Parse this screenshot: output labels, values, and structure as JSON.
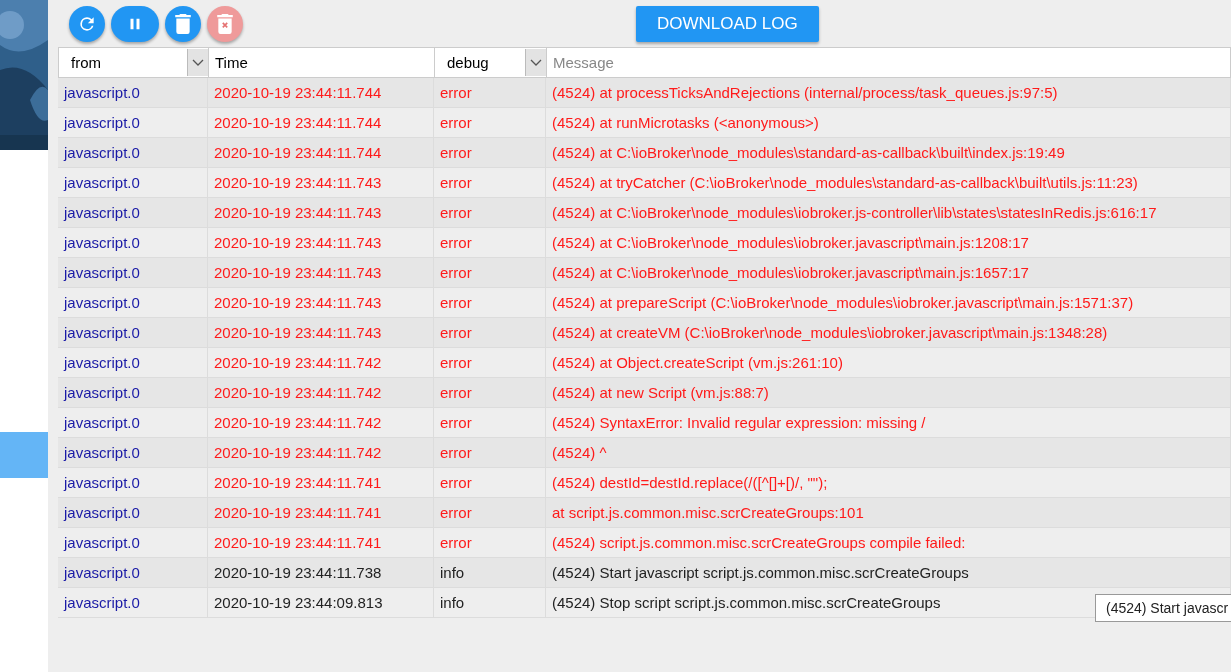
{
  "toolbar": {
    "buttons": [
      {
        "kind": "refresh",
        "disabled": false
      },
      {
        "kind": "pause",
        "disabled": false
      },
      {
        "kind": "delete",
        "disabled": false
      },
      {
        "kind": "delete-log",
        "disabled": true
      }
    ],
    "download": "DOWNLOAD LOG"
  },
  "filters": {
    "from": "from",
    "time": "Time",
    "level": "debug",
    "message_placeholder": "Message"
  },
  "rows": [
    {
      "from": "javascript.0",
      "time": "2020-10-19 23:44:11.744",
      "severity": "error",
      "message": "(4524) at processTicksAndRejections (internal/process/task_queues.js:97:5)"
    },
    {
      "from": "javascript.0",
      "time": "2020-10-19 23:44:11.744",
      "severity": "error",
      "message": "(4524) at runMicrotasks (<anonymous>)"
    },
    {
      "from": "javascript.0",
      "time": "2020-10-19 23:44:11.744",
      "severity": "error",
      "message": "(4524) at C:\\ioBroker\\node_modules\\standard-as-callback\\built\\index.js:19:49"
    },
    {
      "from": "javascript.0",
      "time": "2020-10-19 23:44:11.743",
      "severity": "error",
      "message": "(4524) at tryCatcher (C:\\ioBroker\\node_modules\\standard-as-callback\\built\\utils.js:11:23)"
    },
    {
      "from": "javascript.0",
      "time": "2020-10-19 23:44:11.743",
      "severity": "error",
      "message": "(4524) at C:\\ioBroker\\node_modules\\iobroker.js-controller\\lib\\states\\statesInRedis.js:616:17"
    },
    {
      "from": "javascript.0",
      "time": "2020-10-19 23:44:11.743",
      "severity": "error",
      "message": "(4524) at C:\\ioBroker\\node_modules\\iobroker.javascript\\main.js:1208:17"
    },
    {
      "from": "javascript.0",
      "time": "2020-10-19 23:44:11.743",
      "severity": "error",
      "message": "(4524) at C:\\ioBroker\\node_modules\\iobroker.javascript\\main.js:1657:17"
    },
    {
      "from": "javascript.0",
      "time": "2020-10-19 23:44:11.743",
      "severity": "error",
      "message": "(4524) at prepareScript (C:\\ioBroker\\node_modules\\iobroker.javascript\\main.js:1571:37)"
    },
    {
      "from": "javascript.0",
      "time": "2020-10-19 23:44:11.743",
      "severity": "error",
      "message": "(4524) at createVM (C:\\ioBroker\\node_modules\\iobroker.javascript\\main.js:1348:28)"
    },
    {
      "from": "javascript.0",
      "time": "2020-10-19 23:44:11.742",
      "severity": "error",
      "message": "(4524) at Object.createScript (vm.js:261:10)"
    },
    {
      "from": "javascript.0",
      "time": "2020-10-19 23:44:11.742",
      "severity": "error",
      "message": "(4524) at new Script (vm.js:88:7)"
    },
    {
      "from": "javascript.0",
      "time": "2020-10-19 23:44:11.742",
      "severity": "error",
      "message": "(4524) SyntaxError: Invalid regular expression: missing /"
    },
    {
      "from": "javascript.0",
      "time": "2020-10-19 23:44:11.742",
      "severity": "error",
      "message": "(4524) ^"
    },
    {
      "from": "javascript.0",
      "time": "2020-10-19 23:44:11.741",
      "severity": "error",
      "message": "(4524) destId=destId.replace(/([^[]+[)/, \"\");"
    },
    {
      "from": "javascript.0",
      "time": "2020-10-19 23:44:11.741",
      "severity": "error",
      "message": "at script.js.common.misc.scrCreateGroups:101"
    },
    {
      "from": "javascript.0",
      "time": "2020-10-19 23:44:11.741",
      "severity": "error",
      "message": "(4524) script.js.common.misc.scrCreateGroups compile failed:"
    },
    {
      "from": "javascript.0",
      "time": "2020-10-19 23:44:11.738",
      "severity": "info",
      "message": "(4524) Start javascript script.js.common.misc.scrCreateGroups"
    },
    {
      "from": "javascript.0",
      "time": "2020-10-19 23:44:09.813",
      "severity": "info",
      "message": "(4524) Stop script script.js.common.misc.scrCreateGroups"
    }
  ],
  "tooltip": "(4524) Start javascr"
}
